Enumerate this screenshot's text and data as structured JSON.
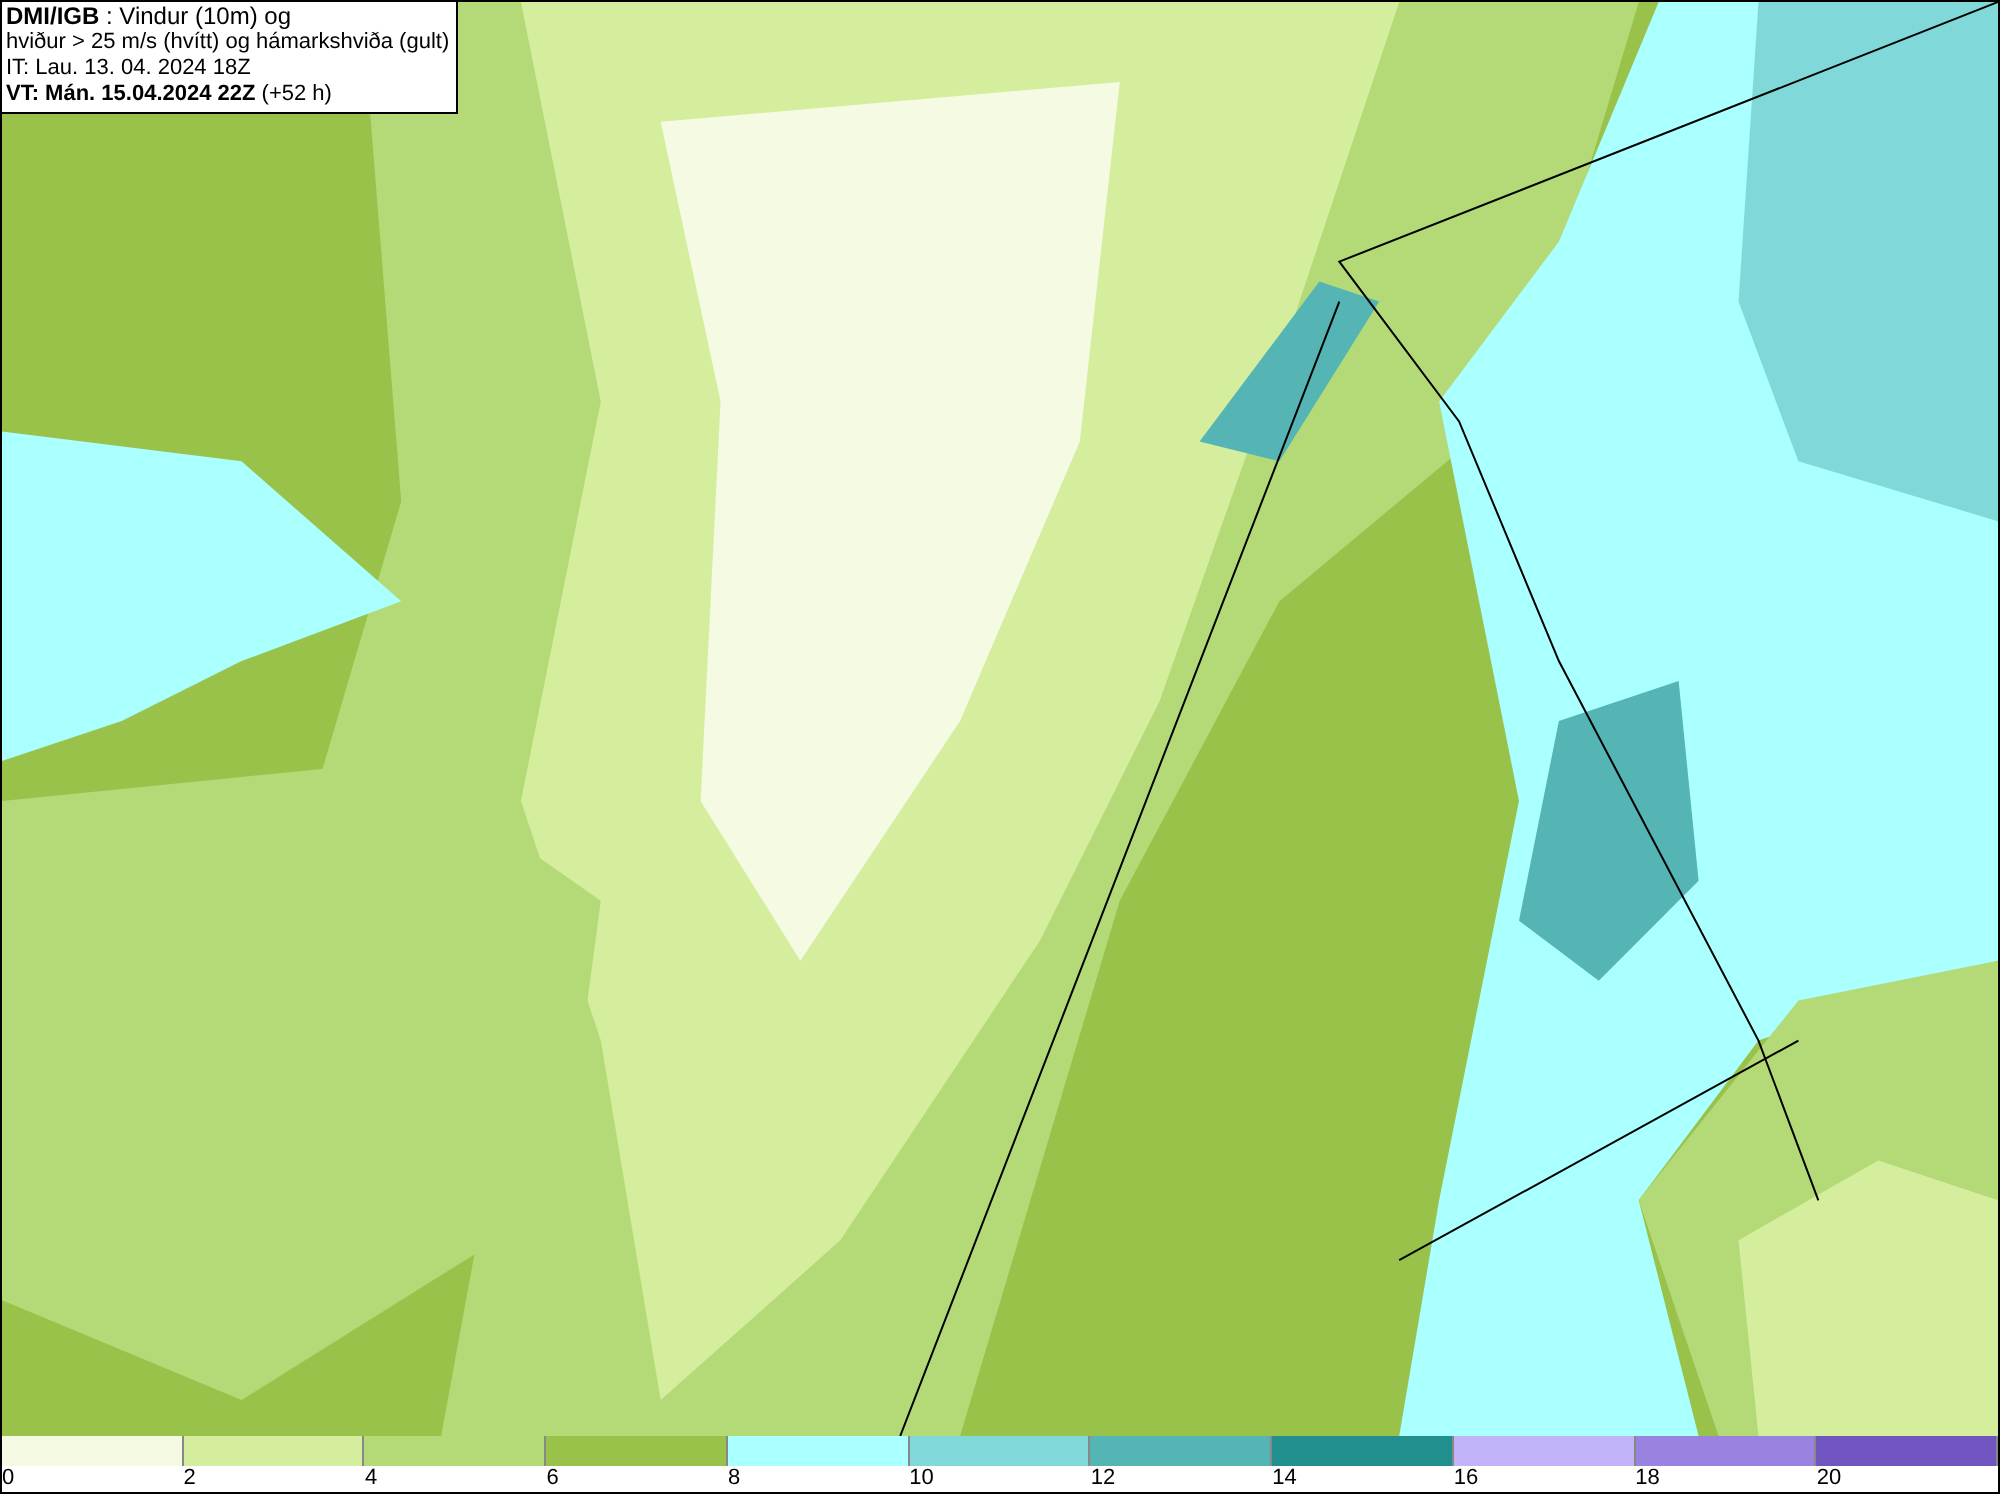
{
  "header": {
    "lines": [
      "**DMI/IGB** : Vindur (10m) og",
      "hviður > 25 m/s (hvítt) og hámarkshviða (gult)",
      "IT: Lau. 13. 04. 2024 18Z",
      "**VT: Mán. 15.04.2024 22Z** (+52 h)"
    ]
  },
  "legend": [
    {
      "label": "0",
      "color": "#f4fbe2"
    },
    {
      "label": "2",
      "color": "#d4ee9e"
    },
    {
      "label": "4",
      "color": "#b4da78"
    },
    {
      "label": "6",
      "color": "#98c24a"
    },
    {
      "label": "8",
      "color": "#aaffff"
    },
    {
      "label": "10",
      "color": "#80d8d8"
    },
    {
      "label": "12",
      "color": "#55b4b4"
    },
    {
      "label": "14",
      "color": "#228f8f"
    },
    {
      "label": "16",
      "color": "#c3b4fa"
    },
    {
      "label": "18",
      "color": "#9a82e0"
    },
    {
      "label": "20",
      "color": "#7055c0"
    }
  ]
}
